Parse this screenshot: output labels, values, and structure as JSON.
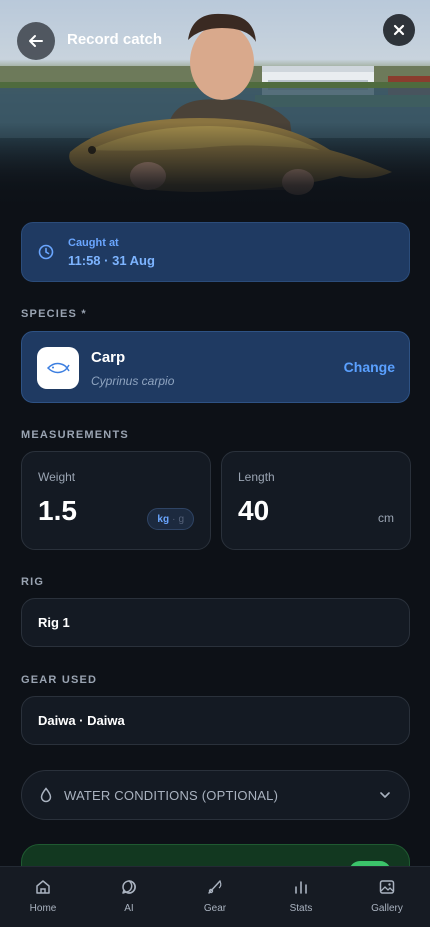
{
  "header": {
    "title": "Record catch",
    "back_icon": "arrow-left-icon",
    "close_icon": "close-icon"
  },
  "caught_at": {
    "label": "Caught at",
    "value": "11:58 · 31 Aug",
    "icon": "clock-icon"
  },
  "species": {
    "section_label": "SPECIES *",
    "name": "Carp",
    "latin": "Cyprinus carpio",
    "change_label": "Change",
    "icon": "fish-icon"
  },
  "measurements": {
    "section_label": "MEASUREMENTS",
    "weight": {
      "label": "Weight",
      "value": "1.5",
      "unit_active": "kg",
      "unit_sep": "·",
      "unit_inactive": "g"
    },
    "length": {
      "label": "Length",
      "value": "40",
      "unit": "cm"
    }
  },
  "rig": {
    "section_label": "RIG",
    "value": "Rig 1"
  },
  "gear": {
    "section_label": "GEAR USED",
    "value": "Daiwa · Daiwa"
  },
  "water_conditions": {
    "label": "WATER CONDITIONS (OPTIONAL)",
    "icon": "droplet-icon",
    "chevron": "chevron-down-icon"
  },
  "colors": {
    "accent": "#5aa0ff",
    "card_blue": "#1f3a62",
    "background": "#0d1117",
    "toggle_green": "#3bc46a"
  },
  "nav": {
    "items": [
      {
        "label": "Home",
        "icon": "home-icon"
      },
      {
        "label": "AI",
        "icon": "chat-icon"
      },
      {
        "label": "Gear",
        "icon": "fishing-rod-icon"
      },
      {
        "label": "Stats",
        "icon": "bar-chart-icon"
      },
      {
        "label": "Gallery",
        "icon": "image-icon"
      }
    ]
  }
}
